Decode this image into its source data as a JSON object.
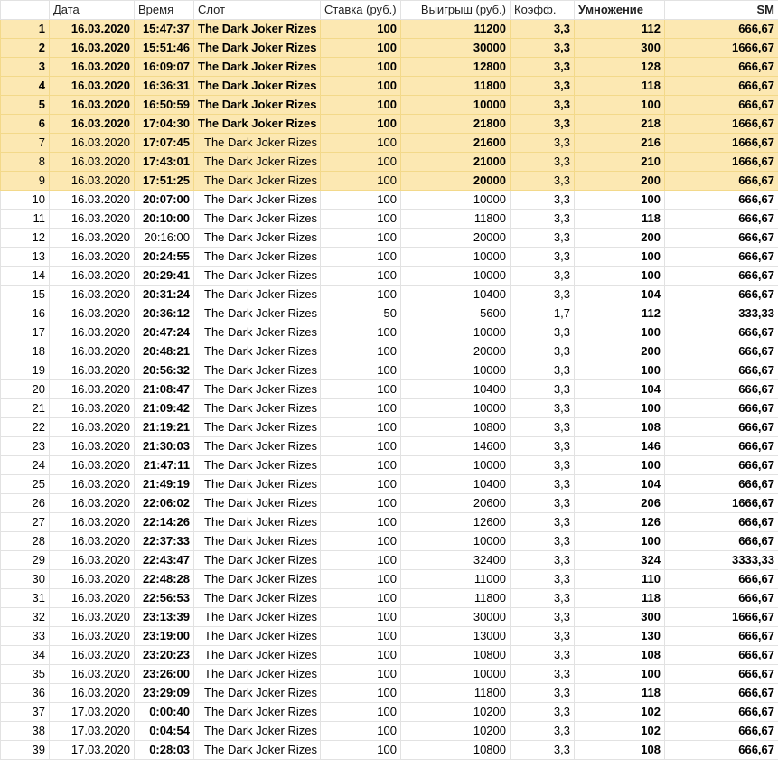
{
  "headers": {
    "col_index": "",
    "date": "Дата",
    "time": "Время",
    "slot": "Слот",
    "bet": "Ставка (руб.)",
    "win": "Выигрыш (руб.)",
    "coef": "Коэфф.",
    "mult": "Умножение",
    "sm": "SM"
  },
  "highlight_color": "#fce8b2",
  "rows": [
    {
      "n": "1",
      "date": "16.03.2020",
      "time": "15:47:37",
      "slot": "The Dark Joker Rizes",
      "bet": "100",
      "win": "11200",
      "coef": "3,3",
      "mult": "112",
      "sm": "666,67",
      "hl": true,
      "bold": true
    },
    {
      "n": "2",
      "date": "16.03.2020",
      "time": "15:51:46",
      "slot": "The Dark Joker Rizes",
      "bet": "100",
      "win": "30000",
      "coef": "3,3",
      "mult": "300",
      "sm": "1666,67",
      "hl": true,
      "bold": true
    },
    {
      "n": "3",
      "date": "16.03.2020",
      "time": "16:09:07",
      "slot": "The Dark Joker Rizes",
      "bet": "100",
      "win": "12800",
      "coef": "3,3",
      "mult": "128",
      "sm": "666,67",
      "hl": true,
      "bold": true
    },
    {
      "n": "4",
      "date": "16.03.2020",
      "time": "16:36:31",
      "slot": "The Dark Joker Rizes",
      "bet": "100",
      "win": "11800",
      "coef": "3,3",
      "mult": "118",
      "sm": "666,67",
      "hl": true,
      "bold": true
    },
    {
      "n": "5",
      "date": "16.03.2020",
      "time": "16:50:59",
      "slot": "The Dark Joker Rizes",
      "bet": "100",
      "win": "10000",
      "coef": "3,3",
      "mult": "100",
      "sm": "666,67",
      "hl": true,
      "bold": true
    },
    {
      "n": "6",
      "date": "16.03.2020",
      "time": "17:04:30",
      "slot": "The Dark Joker Rizes",
      "bet": "100",
      "win": "21800",
      "coef": "3,3",
      "mult": "218",
      "sm": "1666,67",
      "hl": true,
      "bold": true
    },
    {
      "n": "7",
      "date": "16.03.2020",
      "time": "17:07:45",
      "slot": "The Dark Joker Rizes",
      "bet": "100",
      "win": "21600",
      "coef": "3,3",
      "mult": "216",
      "sm": "1666,67",
      "hl": true,
      "bold": false
    },
    {
      "n": "8",
      "date": "16.03.2020",
      "time": "17:43:01",
      "slot": "The Dark Joker Rizes",
      "bet": "100",
      "win": "21000",
      "coef": "3,3",
      "mult": "210",
      "sm": "1666,67",
      "hl": true,
      "bold": false
    },
    {
      "n": "9",
      "date": "16.03.2020",
      "time": "17:51:25",
      "slot": "The Dark Joker Rizes",
      "bet": "100",
      "win": "20000",
      "coef": "3,3",
      "mult": "200",
      "sm": "666,67",
      "hl": true,
      "bold": false
    },
    {
      "n": "10",
      "date": "16.03.2020",
      "time": "20:07:00",
      "slot": "The Dark Joker Rizes",
      "bet": "100",
      "win": "10000",
      "coef": "3,3",
      "mult": "100",
      "sm": "666,67"
    },
    {
      "n": "11",
      "date": "16.03.2020",
      "time": "20:10:00",
      "slot": "The Dark Joker Rizes",
      "bet": "100",
      "win": "11800",
      "coef": "3,3",
      "mult": "118",
      "sm": "666,67"
    },
    {
      "n": "12",
      "date": "16.03.2020",
      "time": "20:16:00",
      "slot": "The Dark Joker Rizes",
      "bet": "100",
      "win": "20000",
      "coef": "3,3",
      "mult": "200",
      "sm": "666,67",
      "time_normal": true
    },
    {
      "n": "13",
      "date": "16.03.2020",
      "time": "20:24:55",
      "slot": "The Dark Joker Rizes",
      "bet": "100",
      "win": "10000",
      "coef": "3,3",
      "mult": "100",
      "sm": "666,67"
    },
    {
      "n": "14",
      "date": "16.03.2020",
      "time": "20:29:41",
      "slot": "The Dark Joker Rizes",
      "bet": "100",
      "win": "10000",
      "coef": "3,3",
      "mult": "100",
      "sm": "666,67"
    },
    {
      "n": "15",
      "date": "16.03.2020",
      "time": "20:31:24",
      "slot": "The Dark Joker Rizes",
      "bet": "100",
      "win": "10400",
      "coef": "3,3",
      "mult": "104",
      "sm": "666,67"
    },
    {
      "n": "16",
      "date": "16.03.2020",
      "time": "20:36:12",
      "slot": "The Dark Joker Rizes",
      "bet": "50",
      "win": "5600",
      "coef": "1,7",
      "mult": "112",
      "sm": "333,33"
    },
    {
      "n": "17",
      "date": "16.03.2020",
      "time": "20:47:24",
      "slot": "The Dark Joker Rizes",
      "bet": "100",
      "win": "10000",
      "coef": "3,3",
      "mult": "100",
      "sm": "666,67"
    },
    {
      "n": "18",
      "date": "16.03.2020",
      "time": "20:48:21",
      "slot": "The Dark Joker Rizes",
      "bet": "100",
      "win": "20000",
      "coef": "3,3",
      "mult": "200",
      "sm": "666,67"
    },
    {
      "n": "19",
      "date": "16.03.2020",
      "time": "20:56:32",
      "slot": "The Dark Joker Rizes",
      "bet": "100",
      "win": "10000",
      "coef": "3,3",
      "mult": "100",
      "sm": "666,67"
    },
    {
      "n": "20",
      "date": "16.03.2020",
      "time": "21:08:47",
      "slot": "The Dark Joker Rizes",
      "bet": "100",
      "win": "10400",
      "coef": "3,3",
      "mult": "104",
      "sm": "666,67"
    },
    {
      "n": "21",
      "date": "16.03.2020",
      "time": "21:09:42",
      "slot": "The Dark Joker Rizes",
      "bet": "100",
      "win": "10000",
      "coef": "3,3",
      "mult": "100",
      "sm": "666,67"
    },
    {
      "n": "22",
      "date": "16.03.2020",
      "time": "21:19:21",
      "slot": "The Dark Joker Rizes",
      "bet": "100",
      "win": "10800",
      "coef": "3,3",
      "mult": "108",
      "sm": "666,67"
    },
    {
      "n": "23",
      "date": "16.03.2020",
      "time": "21:30:03",
      "slot": "The Dark Joker Rizes",
      "bet": "100",
      "win": "14600",
      "coef": "3,3",
      "mult": "146",
      "sm": "666,67"
    },
    {
      "n": "24",
      "date": "16.03.2020",
      "time": "21:47:11",
      "slot": "The Dark Joker Rizes",
      "bet": "100",
      "win": "10000",
      "coef": "3,3",
      "mult": "100",
      "sm": "666,67"
    },
    {
      "n": "25",
      "date": "16.03.2020",
      "time": "21:49:19",
      "slot": "The Dark Joker Rizes",
      "bet": "100",
      "win": "10400",
      "coef": "3,3",
      "mult": "104",
      "sm": "666,67"
    },
    {
      "n": "26",
      "date": "16.03.2020",
      "time": "22:06:02",
      "slot": "The Dark Joker Rizes",
      "bet": "100",
      "win": "20600",
      "coef": "3,3",
      "mult": "206",
      "sm": "1666,67"
    },
    {
      "n": "27",
      "date": "16.03.2020",
      "time": "22:14:26",
      "slot": "The Dark Joker Rizes",
      "bet": "100",
      "win": "12600",
      "coef": "3,3",
      "mult": "126",
      "sm": "666,67"
    },
    {
      "n": "28",
      "date": "16.03.2020",
      "time": "22:37:33",
      "slot": "The Dark Joker Rizes",
      "bet": "100",
      "win": "10000",
      "coef": "3,3",
      "mult": "100",
      "sm": "666,67"
    },
    {
      "n": "29",
      "date": "16.03.2020",
      "time": "22:43:47",
      "slot": "The Dark Joker Rizes",
      "bet": "100",
      "win": "32400",
      "coef": "3,3",
      "mult": "324",
      "sm": "3333,33"
    },
    {
      "n": "30",
      "date": "16.03.2020",
      "time": "22:48:28",
      "slot": "The Dark Joker Rizes",
      "bet": "100",
      "win": "11000",
      "coef": "3,3",
      "mult": "110",
      "sm": "666,67"
    },
    {
      "n": "31",
      "date": "16.03.2020",
      "time": "22:56:53",
      "slot": "The Dark Joker Rizes",
      "bet": "100",
      "win": "11800",
      "coef": "3,3",
      "mult": "118",
      "sm": "666,67"
    },
    {
      "n": "32",
      "date": "16.03.2020",
      "time": "23:13:39",
      "slot": "The Dark Joker Rizes",
      "bet": "100",
      "win": "30000",
      "coef": "3,3",
      "mult": "300",
      "sm": "1666,67"
    },
    {
      "n": "33",
      "date": "16.03.2020",
      "time": "23:19:00",
      "slot": "The Dark Joker Rizes",
      "bet": "100",
      "win": "13000",
      "coef": "3,3",
      "mult": "130",
      "sm": "666,67"
    },
    {
      "n": "34",
      "date": "16.03.2020",
      "time": "23:20:23",
      "slot": "The Dark Joker Rizes",
      "bet": "100",
      "win": "10800",
      "coef": "3,3",
      "mult": "108",
      "sm": "666,67"
    },
    {
      "n": "35",
      "date": "16.03.2020",
      "time": "23:26:00",
      "slot": "The Dark Joker Rizes",
      "bet": "100",
      "win": "10000",
      "coef": "3,3",
      "mult": "100",
      "sm": "666,67"
    },
    {
      "n": "36",
      "date": "16.03.2020",
      "time": "23:29:09",
      "slot": "The Dark Joker Rizes",
      "bet": "100",
      "win": "11800",
      "coef": "3,3",
      "mult": "118",
      "sm": "666,67"
    },
    {
      "n": "37",
      "date": "17.03.2020",
      "time": "0:00:40",
      "slot": "The Dark Joker Rizes",
      "bet": "100",
      "win": "10200",
      "coef": "3,3",
      "mult": "102",
      "sm": "666,67"
    },
    {
      "n": "38",
      "date": "17.03.2020",
      "time": "0:04:54",
      "slot": "The Dark Joker Rizes",
      "bet": "100",
      "win": "10200",
      "coef": "3,3",
      "mult": "102",
      "sm": "666,67"
    },
    {
      "n": "39",
      "date": "17.03.2020",
      "time": "0:28:03",
      "slot": "The Dark Joker Rizes",
      "bet": "100",
      "win": "10800",
      "coef": "3,3",
      "mult": "108",
      "sm": "666,67"
    }
  ]
}
